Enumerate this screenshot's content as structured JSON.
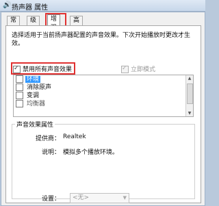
{
  "window": {
    "title": "扬声器 属性"
  },
  "tabs": [
    {
      "label": "常规"
    },
    {
      "label": "级别"
    },
    {
      "label": "增强"
    },
    {
      "label": "高级"
    }
  ],
  "active_tab": "增强",
  "description": "选择适用于当前扬声器配置的声音效果。下次开始播放时更改才生效。",
  "disable_all": {
    "label": "禁用所有声音效果",
    "checked": true
  },
  "immediate_mode": {
    "label": "立即模式",
    "checked": true,
    "enabled": false
  },
  "effects": [
    {
      "label": "环境",
      "checked": false,
      "selected": true
    },
    {
      "label": "消除原声",
      "checked": false
    },
    {
      "label": "变调",
      "checked": false
    },
    {
      "label": "均衡器",
      "checked": false
    }
  ],
  "properties": {
    "title": "声音效果属性",
    "provider_label": "提供商：",
    "provider_value": "Realtek",
    "desc_label": "说明：",
    "desc_value": "模拟多个播放环境。",
    "setting_label": "设置：",
    "setting_value": "<无>"
  },
  "colors": {
    "highlight": "#e03030",
    "selection": "#3399ff"
  },
  "icons": {
    "title_icon": "speaker-icon"
  }
}
